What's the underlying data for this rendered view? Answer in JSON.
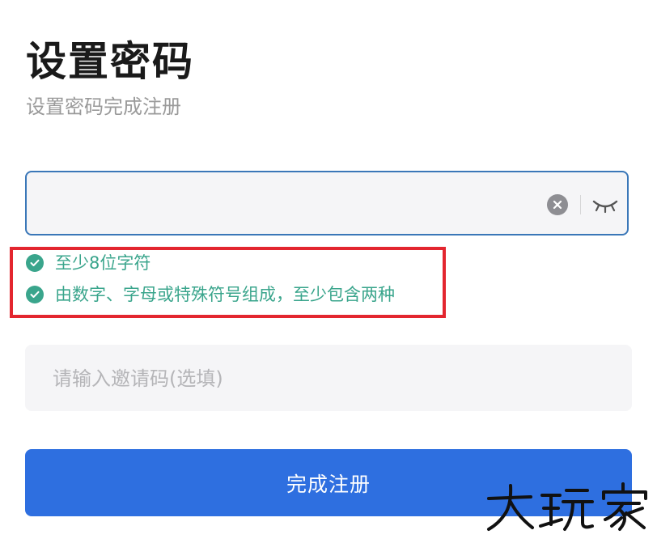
{
  "header": {
    "title": "设置密码",
    "subtitle": "设置密码完成注册"
  },
  "password_field": {
    "value": "",
    "placeholder": "",
    "clear_icon": "clear-circle-icon",
    "visibility_icon": "eye-closed-icon"
  },
  "rules": [
    {
      "text": "至少8位字符",
      "status": "passed"
    },
    {
      "text": "由数字、字母或特殊符号组成，至少包含两种",
      "status": "passed"
    }
  ],
  "invite_field": {
    "value": "",
    "placeholder": "请输入邀请码(选填)"
  },
  "submit": {
    "label": "完成注册"
  },
  "watermark": {
    "text": "大玩家"
  },
  "colors": {
    "primary": "#2e6fe0",
    "success": "#3aa58c",
    "highlight": "#e3262f",
    "field_border": "#3a77b8"
  }
}
